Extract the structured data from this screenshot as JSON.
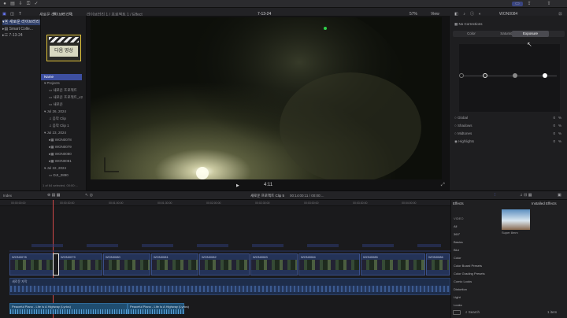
{
  "app": {
    "library_name": "새로운 라이브러리 1",
    "event_path": "라이브러리 1 / 프로젝트 1 / Effect",
    "project_name": "7-13-24",
    "zoom": "57%",
    "view_label": "View",
    "inspector_title": "WON0084"
  },
  "sidebar": {
    "items": [
      {
        "label": "새로운 라이브러리"
      },
      {
        "label": "Smart Colle..."
      },
      {
        "label": "7-13-24"
      }
    ]
  },
  "browser": {
    "thumb_label": "다음 영상",
    "header": "Name",
    "rows": [
      {
        "label": "Projects"
      },
      {
        "label": "새로운 프로젝트"
      },
      {
        "label": "새로운 프로젝트_v2"
      },
      {
        "label": "새로운"
      },
      {
        "label": "Jul 26, 2024"
      },
      {
        "label": "음악 Clip"
      },
      {
        "label": "음악 Clip 1"
      },
      {
        "label": "Jul 23, 2024"
      },
      {
        "label": "WON0078"
      },
      {
        "label": "WON0079"
      },
      {
        "label": "WON0080"
      },
      {
        "label": "WON0081"
      },
      {
        "label": "Jul 22, 2024"
      },
      {
        "label": "DJI_0890"
      }
    ],
    "footer": "1 of 64 selected, 00:00:..."
  },
  "viewer": {
    "timecode": "4:11",
    "play_icon": "play-icon"
  },
  "inspector": {
    "correction": "No Corrections",
    "tabs": [
      "Color",
      "Saturation",
      "Exposure"
    ],
    "active_tab": "Exposure",
    "params": [
      {
        "name": "Global",
        "value": "0",
        "unit": "%"
      },
      {
        "name": "Shadows",
        "value": "0",
        "unit": "%"
      },
      {
        "name": "Midtones",
        "value": "0",
        "unit": "%"
      },
      {
        "name": "Highlights",
        "value": "0",
        "unit": "%"
      }
    ]
  },
  "timeline": {
    "index_label": "Index",
    "project_label": "새로운 프로젝트 Clip 5",
    "duration": "00:14:00:11 / 00:00:...",
    "ruler": [
      "00:00:00:00",
      "00:00:30:00",
      "00:01:00:00",
      "00:01:30:00",
      "00:02:00:00",
      "00:02:30:00",
      "00:03:00:00",
      "00:03:30:00",
      "00:04:00:00"
    ],
    "title_track": "새로운 자막",
    "clips": [
      {
        "label": "WON0078"
      },
      {
        "label": "WON0079"
      },
      {
        "label": "WON0080"
      },
      {
        "label": "WON0081"
      },
      {
        "label": "WON0082"
      },
      {
        "label": "WON0083"
      },
      {
        "label": "WON0084"
      },
      {
        "label": "WON0085"
      },
      {
        "label": "WON0086"
      }
    ],
    "audio1": "Peaceful Piano - Life Is A Highway (Lyrics)",
    "audio2": "Peaceful Piano - Life Is A Highway (Lyrics)"
  },
  "effects": {
    "title": "Effects",
    "installed": "Installed Effects",
    "categories": [
      "VIDEO",
      "All",
      "360°",
      "Basics",
      "Blur",
      "Color",
      "Color Board Presets",
      "Color Grading Presets",
      "Comic Looks",
      "Distortion",
      "Light",
      "Looks"
    ],
    "thumb_label": "Super 8mm",
    "search_placeholder": "Search",
    "count": "1 item"
  }
}
